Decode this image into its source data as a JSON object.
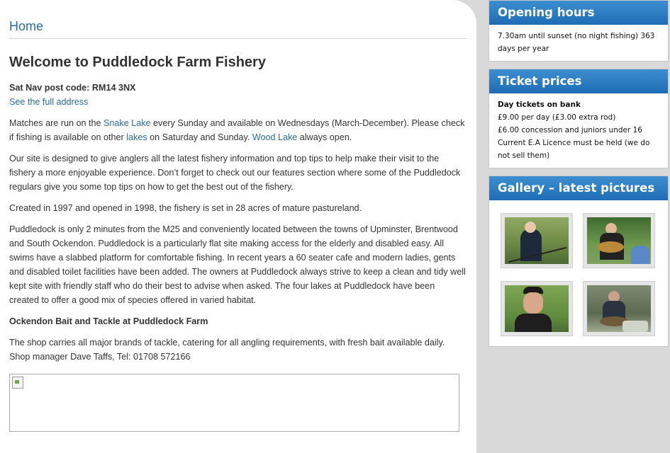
{
  "breadcrumb": "Home",
  "title": "Welcome to Puddledock Farm Fishery",
  "sat_nav": "Sat Nav post code: RM14 3NX",
  "full_address_link": "See the full address",
  "matches": {
    "t1": "Matches are run on the ",
    "snake_lake": "Snake Lake",
    "t2": " every Sunday and available on Wednesdays (March-December).  Please check if fishing is available on other ",
    "lakes": "lakes",
    "t3": " on Saturday and Sunday. ",
    "wood_lake": "Wood Lake",
    "t4": " always open."
  },
  "para_site": "Our site is designed to give anglers all the latest fishery information and top tips to help make their visit to the fishery a more enjoyable experience. Don’t forget to check out our features section where some of the Puddledock regulars give you some top tips on how to get the best out of the fishery.",
  "para_created": "Created in 1997 and opened in 1998, the fishery is set in 28 acres of mature pastureland.",
  "para_location": "Puddledock is only 2 minutes from the M25 and conveniently located between the towns of Upminster, Brentwood and South Ockendon. Puddledock is a particularly flat site making access for the elderly and disabled easy. All swims have a slabbed platform for comfortable fishing. In recent years a 60 seater cafe and modern ladies, gents and disabled toilet facilities have been added. The owners at Puddledock always strive to keep a clean and tidy well kept site with friendly staff who do their best to advise when asked. The four lakes at Puddledock have been created to offer a good mix of species offered in varied habitat.",
  "shop_heading": "Ockendon Bait and Tackle at Puddledock Farm",
  "shop_line1": "The  shop carries all major brands of tackle, catering for all angling requirements, with fresh bait available daily.",
  "shop_line2": "Shop manager  Dave Taffs, Tel:  01708 572166",
  "sidebar": {
    "opening_title": "Opening hours",
    "opening_text": "7.30am until sunset (no night fishing) 363 days per year",
    "ticket_title": "Ticket prices",
    "ticket_heading": "Day tickets on bank",
    "ticket_lines": [
      "£9.00 per day (£3.00 extra rod)",
      "£6.00 concession and juniors under 16",
      "Current E.A Licence must be held (we do not sell them)"
    ],
    "gallery_title": "Gallery – latest pictures"
  },
  "colors": {
    "link": "#2a6ca0",
    "widget_header": "#2676bf",
    "sidebar_bg": "#d9d9d9"
  }
}
